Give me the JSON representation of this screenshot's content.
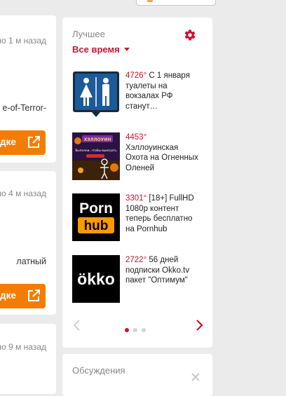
{
  "left_column": {
    "card1": {
      "time": "но 1 м назад",
      "snippet": "e-of-Terror-",
      "button_label": "дке"
    },
    "card2": {
      "time": "но 4 м назад",
      "snippet": "латный",
      "button_label": "дке"
    },
    "card3": {
      "time": "но 9 м назад"
    }
  },
  "best": {
    "title": "Лучшее",
    "filter": "Все время",
    "items": [
      {
        "temp": "4726°",
        "text": "С 1 января туалеты на вокзалах РФ станут…",
        "icon": "toilet-sign-icon"
      },
      {
        "temp": "4453°",
        "text": "Хэллоуинская Охота на Огненных Оленей",
        "icon": "halloween-game-art",
        "thumb_caption": "ХЭЛЛОУИН",
        "thumb_sub": "Выполни, чтобы выиграть"
      },
      {
        "temp": "3301°",
        "text": "[18+] FullHD 1080p контент теперь бесплатно на Pornhub",
        "logo_top": "Porn",
        "logo_bottom": "hub"
      },
      {
        "temp": "2722°",
        "text": "56 дней подписки Okko.tv пакет \"Оптимум\"",
        "logo": "ökko"
      }
    ],
    "pagination": {
      "pages": 3,
      "active": 0
    }
  },
  "discussions": {
    "title": "Обсуждения"
  },
  "colors": {
    "accent": "#c5152e",
    "deal_button": "#f47c00"
  }
}
